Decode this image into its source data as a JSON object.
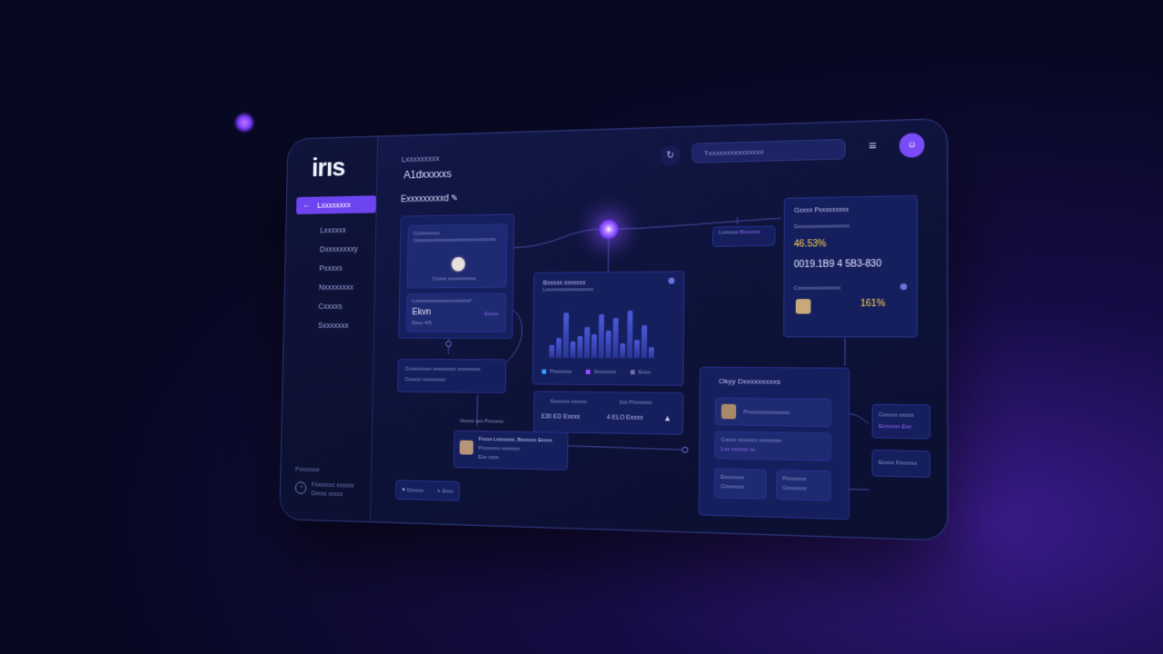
{
  "sidebar": {
    "logo": "irıs",
    "active_item": "Lxxxxxxxx",
    "items": [
      "Lxxxxxx",
      "Dxxxxxxxxy",
      "Pxxxxs",
      "Nxxxxxxxx",
      "Cxxxxs",
      "Sxxxxxxx"
    ],
    "footer_title": "Pxxxxxxx",
    "footer_user": "Fxxxxxxx xxxxxx",
    "footer_user_sub": "Dxxxx xxxxx"
  },
  "header": {
    "subtitle": "Lxxxxxxxxx",
    "title": "A1dxxxxxs",
    "section": "Exxxxxxxxxd",
    "search_placeholder": "Txxxxxxxxxxxxxxx"
  },
  "cards": {
    "profile": {
      "caption_1": "Cxxxxxxxxx",
      "caption_2": "Cxxxxxxxxxxxxxxxxxxxxxxxxxxxxxxx",
      "avatar_caption": "Cxxxx xxxxxxxxxxx",
      "subtitle": "Lxxxxxxxxxxxxxxxxxxxxxx\"",
      "name": "Ekvn",
      "amount": "Dxxx 4/5",
      "tag": "Exxxx"
    },
    "note": {
      "line_1": "Cxxxxxxxxx xxxxxxxxx xxxxxxxxx",
      "line_2": "Cxxxxx xxxxxxxxx"
    },
    "chart": {
      "title": "Bxxxxx xxxxxxx",
      "subtitle": "Lxxxxxxxxxxxxxxxxxx",
      "legend": [
        "Pxxxxxxx",
        "Sxxxxxxx",
        "Exxx"
      ]
    },
    "flow_small": {
      "label": "Lxxxxxx",
      "value": "Bxxxxxx"
    },
    "stats": {
      "label_1": "Sxxxxxx xxxxxx",
      "label_2": "1xx Pxxxxxxx",
      "value_1": "£30 ЕD Exxxx",
      "value_2": "4 ELO Exxxx"
    },
    "metrics": {
      "title": "Gxxxx Pxxxxxxxxx",
      "subtitle": "Dxxxxxxxxxxxxxxxxxx",
      "pct_1": "46.53%",
      "code": "0019.1B9 4 5B3-830",
      "row_label": "Cxxxxxxxxxxxxxxx",
      "pct_2": "161%"
    },
    "person": {
      "name": "Fxxxx Lxxxxxxx, Bxxxxxx Exxxx",
      "sub_1": "Pxxxxxxx xxxxxxx",
      "sub_2": "Exx xxxx"
    },
    "insights": {
      "title": "Okyy Dxxxxxxxxxs",
      "row_1": "Pxxxxxxxxxxxxxxx",
      "row_2": "Cxxxx xxxxxxx xxxxxxxx",
      "row_2b": "Lxx xxxxxx xx",
      "btn_1a": "Exxxxxxx",
      "btn_1b": "Cxxxxxxx",
      "btn_2a": "Pxxxxxxx",
      "btn_2b": "Cxxxxxxx"
    },
    "side_right": {
      "label_1": "Cxxxxx xxxxx",
      "label_1b": "Exxxxxx Exx",
      "label_2": "Exxxx Fxxxxxx"
    },
    "flow_label": "Hxxxx xxx Pxxxxxx",
    "bottom_bar": {
      "left": "Dxxxxx",
      "right": "Exxx"
    }
  },
  "colors": {
    "accent": "#6d44f0",
    "highlight": "#ffd34d",
    "background": "#070822"
  }
}
